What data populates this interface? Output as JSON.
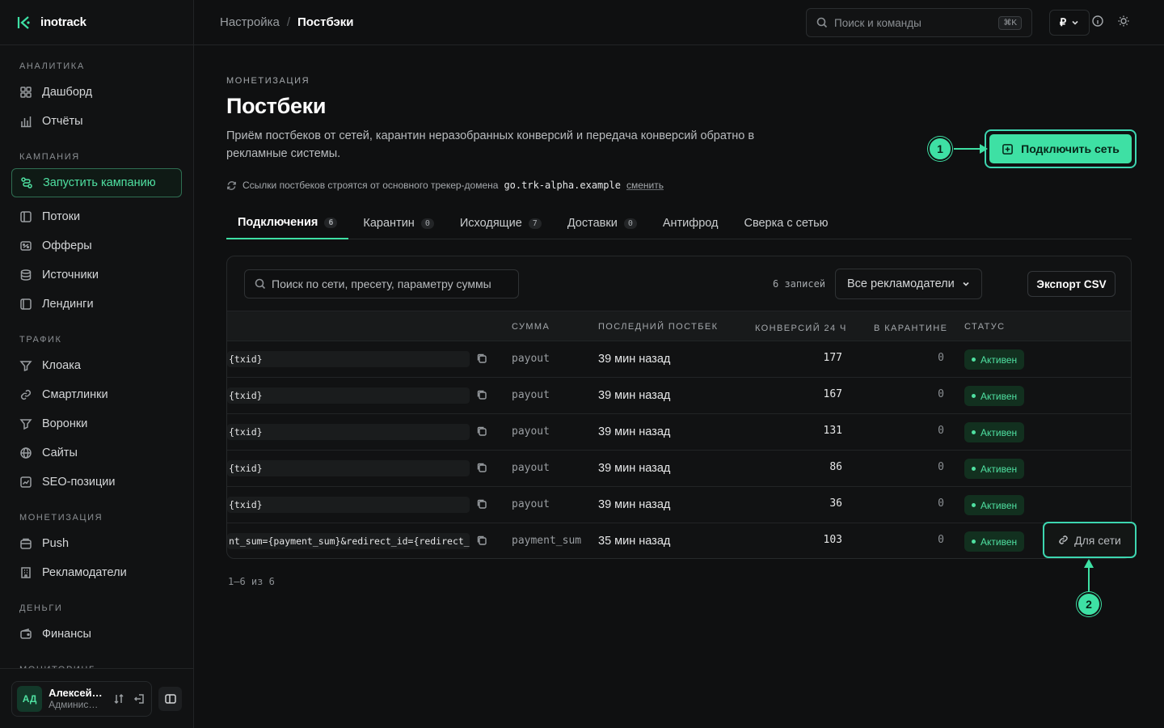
{
  "brand": {
    "name": "inotrack"
  },
  "sidebar": {
    "sections": [
      {
        "title": "АНАЛИТИКА",
        "items": [
          {
            "label": "Дашборд",
            "icon": "dashboard-icon"
          },
          {
            "label": "Отчёты",
            "icon": "reports-icon"
          }
        ]
      },
      {
        "title": "КАМПАНИЯ",
        "items": [
          {
            "label": "Запустить кампанию",
            "icon": "launch-icon",
            "active": true
          },
          {
            "label": "Потоки",
            "icon": "streams-icon"
          },
          {
            "label": "Офферы",
            "icon": "offers-icon"
          },
          {
            "label": "Источники",
            "icon": "sources-icon"
          },
          {
            "label": "Лендинги",
            "icon": "landings-icon"
          }
        ]
      },
      {
        "title": "ТРАФИК",
        "items": [
          {
            "label": "Клоака",
            "icon": "filter-icon"
          },
          {
            "label": "Смартлинки",
            "icon": "link-icon"
          },
          {
            "label": "Воронки",
            "icon": "funnel-icon"
          },
          {
            "label": "Сайты",
            "icon": "globe-icon"
          },
          {
            "label": "SEO-позиции",
            "icon": "seo-icon"
          }
        ]
      },
      {
        "title": "МОНЕТИЗАЦИЯ",
        "items": [
          {
            "label": "Push",
            "icon": "push-icon"
          },
          {
            "label": "Рекламодатели",
            "icon": "building-icon"
          }
        ]
      },
      {
        "title": "ДЕНЬГИ",
        "items": [
          {
            "label": "Финансы",
            "icon": "wallet-icon"
          }
        ]
      },
      {
        "title": "МОНИТОРИНГ",
        "items": []
      }
    ],
    "user": {
      "initials": "АД",
      "name": "Алексей…",
      "role": "Админис…"
    }
  },
  "topbar": {
    "breadcrumb_parent": "Настройка",
    "breadcrumb_sep": "/",
    "breadcrumb_current": "Постбэки",
    "search_placeholder": "Поиск и команды",
    "search_kbd": "⌘K",
    "currency": "₽"
  },
  "page": {
    "eyebrow": "МОНЕТИЗАЦИЯ",
    "title": "Постбеки",
    "description": "Приём постбеков от сетей, карантин неразобранных конверсий и передача конверсий обратно в рекламные системы.",
    "domain_note_prefix": "Ссылки постбеков строятся от основного трекер-домена",
    "domain": "go.trk-alpha.example",
    "domain_change": "сменить",
    "connect_button": "Подключить сеть"
  },
  "tabs": [
    {
      "label": "Подключения",
      "count": "6",
      "active": true
    },
    {
      "label": "Карантин",
      "count": "0"
    },
    {
      "label": "Исходящие",
      "count": "7"
    },
    {
      "label": "Доставки",
      "count": "0"
    },
    {
      "label": "Антифрод",
      "count": null
    },
    {
      "label": "Сверка с сетью",
      "count": null
    }
  ],
  "table": {
    "search_placeholder": "Поиск по сети, пресету, параметру суммы",
    "records_count": "6 записей",
    "advertiser_filter": "Все рекламодатели",
    "export_button": "Экспорт CSV",
    "columns": {
      "sum": "СУММА",
      "last": "ПОСЛЕДНИЙ ПОСТБЕК",
      "conv": "КОНВЕРСИЙ 24 Ч",
      "quar": "В КАРАНТИНЕ",
      "status": "СТАТУС"
    },
    "rows": [
      {
        "url": "{txid}",
        "param": "payout",
        "last": "39 мин назад",
        "conv": "177",
        "quar": "0",
        "status": "Активен"
      },
      {
        "url": "{txid}",
        "param": "payout",
        "last": "39 мин назад",
        "conv": "167",
        "quar": "0",
        "status": "Активен"
      },
      {
        "url": "{txid}",
        "param": "payout",
        "last": "39 мин назад",
        "conv": "131",
        "quar": "0",
        "status": "Активен"
      },
      {
        "url": "{txid}",
        "param": "payout",
        "last": "39 мин назад",
        "conv": "86",
        "quar": "0",
        "status": "Активен"
      },
      {
        "url": "{txid}",
        "param": "payout",
        "last": "39 мин назад",
        "conv": "36",
        "quar": "0",
        "status": "Активен"
      },
      {
        "url": "nt_sum={payment_sum}&redirect_id={redirect_id}",
        "param": "payment_sum",
        "last": "35 мин назад",
        "conv": "103",
        "quar": "0",
        "status": "Активен"
      }
    ],
    "row_action": "Для сети",
    "pagination": "1–6 из 6"
  },
  "annotations": {
    "marker1": "1",
    "marker2": "2"
  },
  "colors": {
    "accent": "#3ee0a4",
    "background": "#0f1011",
    "status_active": "#4fe0a1"
  }
}
